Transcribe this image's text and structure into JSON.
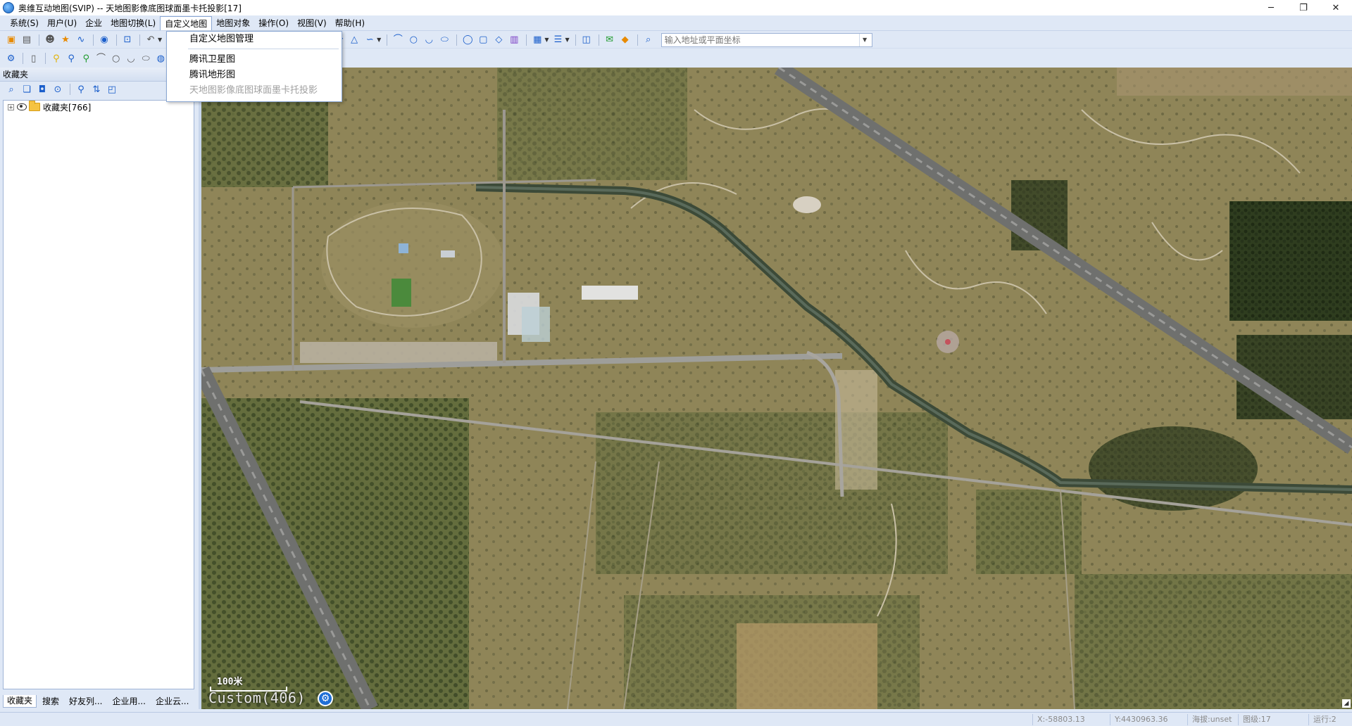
{
  "window": {
    "title": "奥维互动地图(SVIP) -- 天地图影像底图球面墨卡托投影[17]",
    "minimize": "─",
    "restore": "❐",
    "close": "✕"
  },
  "menubar": {
    "items": [
      {
        "label": "系统(S)"
      },
      {
        "label": "用户(U)"
      },
      {
        "label": "企业"
      },
      {
        "label": "地图切换(L)"
      },
      {
        "label": "自定义地图"
      },
      {
        "label": "地图对象"
      },
      {
        "label": "操作(O)"
      },
      {
        "label": "视图(V)"
      },
      {
        "label": "帮助(H)"
      }
    ]
  },
  "dropdown": {
    "items": [
      {
        "label": "自定义地图管理",
        "enabled": true
      },
      {
        "label": "腾讯卫星图",
        "enabled": true
      },
      {
        "label": "腾讯地形图",
        "enabled": true
      },
      {
        "label": "天地图影像底图球面墨卡托投影",
        "enabled": false
      }
    ]
  },
  "search": {
    "placeholder": "输入地址或平面坐标"
  },
  "left_panel": {
    "header": "收藏夹",
    "tree": [
      {
        "label": "收藏夹[766]"
      }
    ],
    "tabs": [
      {
        "label": "收藏夹"
      },
      {
        "label": "搜索"
      },
      {
        "label": "好友列..."
      },
      {
        "label": "企业用..."
      },
      {
        "label": "企业云..."
      }
    ]
  },
  "map": {
    "scale_label": "100米",
    "source_label": "Custom(406)"
  },
  "status": {
    "x": "X:-58803.13",
    "y": "Y:4430963.36",
    "altitude": "海拔:unset",
    "level": "图级:17",
    "running": "运行:2"
  }
}
